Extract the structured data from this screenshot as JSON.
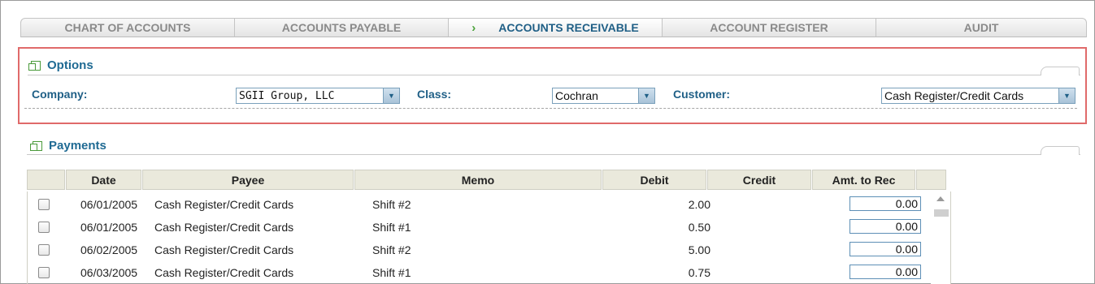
{
  "tabs": [
    {
      "label": "CHART OF ACCOUNTS",
      "active": false
    },
    {
      "label": "ACCOUNTS PAYABLE",
      "active": false
    },
    {
      "label": "ACCOUNTS RECEIVABLE",
      "active": true,
      "indicator": "›"
    },
    {
      "label": "ACCOUNT REGISTER",
      "active": false
    },
    {
      "label": "AUDIT",
      "active": false
    }
  ],
  "options": {
    "title": "Options",
    "company_label": "Company:",
    "company_value": "SGII Group, LLC",
    "class_label": "Class:",
    "class_value": "Cochran",
    "customer_label": "Customer:",
    "customer_value": "Cash Register/Credit Cards",
    "dropdown_glyph": "▼"
  },
  "payments": {
    "title": "Payments",
    "columns": [
      "",
      "Date",
      "Payee",
      "Memo",
      "Debit",
      "Credit",
      "Amt. to Rec",
      ""
    ],
    "rows": [
      {
        "date": "06/01/2005",
        "payee": "Cash Register/Credit Cards",
        "memo": "Shift #2",
        "debit": "2.00",
        "credit": "",
        "amt": "0.00"
      },
      {
        "date": "06/01/2005",
        "payee": "Cash Register/Credit Cards",
        "memo": "Shift #1",
        "debit": "0.50",
        "credit": "",
        "amt": "0.00"
      },
      {
        "date": "06/02/2005",
        "payee": "Cash Register/Credit Cards",
        "memo": "Shift #2",
        "debit": "5.00",
        "credit": "",
        "amt": "0.00"
      },
      {
        "date": "06/03/2005",
        "payee": "Cash Register/Credit Cards",
        "memo": "Shift #1",
        "debit": "0.75",
        "credit": "",
        "amt": "0.00"
      }
    ]
  },
  "colors": {
    "accent": "#1f6a93",
    "highlight_border": "#e06a6a",
    "header_bg": "#eae9dc",
    "green_icon": "#4a9a3a"
  }
}
